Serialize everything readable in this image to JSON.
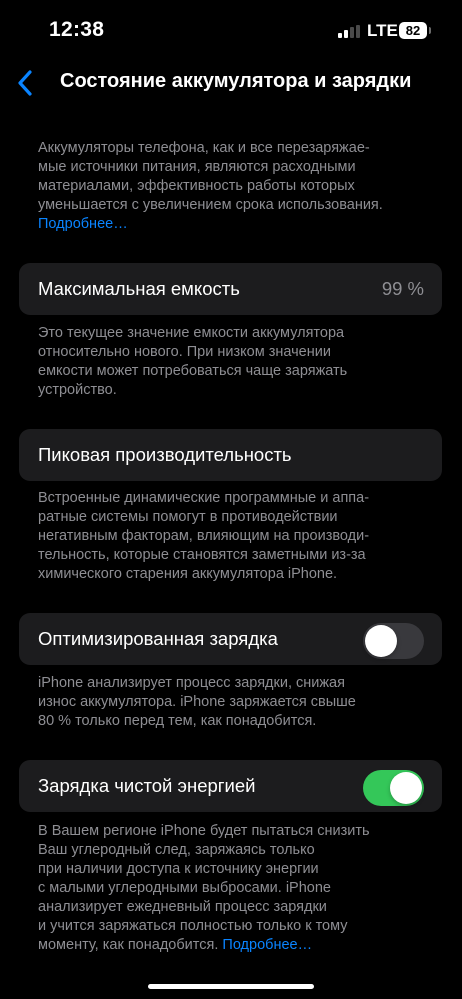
{
  "status_bar": {
    "time": "12:38",
    "network": "LTE",
    "battery_level": "82"
  },
  "nav": {
    "title": "Состояние аккумулятора и зарядки",
    "back_icon": "chevron-left-icon"
  },
  "intro": {
    "lines": [
      "Аккумуляторы телефона, как и все перезаряжае-",
      "мые источники питания, являются расходными",
      "материалами, эффективность работы которых",
      "уменьшается с увеличением срока использования."
    ],
    "link": "Подробнее…"
  },
  "max_capacity": {
    "label": "Максимальная емкость",
    "value": "99 %",
    "footer_lines": [
      "Это текущее значение емкости аккумулятора",
      "относительно нового. При низком значении",
      "емкости может потребоваться чаще заряжать",
      "устройство."
    ]
  },
  "peak_performance": {
    "label": "Пиковая производительность",
    "footer_lines": [
      "Встроенные динамические программные и аппа-",
      "ратные системы помогут в противодействии",
      "негативным факторам, влияющим на производи-",
      "тельность, которые становятся заметными из-за",
      "химического старения аккумулятора iPhone."
    ]
  },
  "optimized_charging": {
    "label": "Оптимизированная зарядка",
    "enabled": false,
    "footer_lines": [
      "iPhone анализирует процесс зарядки, снижая",
      "износ аккумулятора. iPhone заряжается свыше",
      "80 % только перед тем, как понадобится."
    ]
  },
  "clean_energy_charging": {
    "label": "Зарядка чистой энергией",
    "enabled": true,
    "footer_lines": [
      "В Вашем регионе iPhone будет пытаться снизить",
      "Ваш углеродный след, заряжаясь только",
      "при наличии доступа к источнику энергии",
      "с малыми углеродными выбросами. iPhone",
      "анализирует ежедневный процесс зарядки",
      "и учится заряжаться полностью только к тому"
    ],
    "footer_last_line": "моменту, как понадобится.",
    "link": "Подробнее…"
  },
  "colors": {
    "background": "#000000",
    "cell_background": "#1c1c1e",
    "secondary_text": "#8e8e93",
    "link": "#0a84ff",
    "toggle_on": "#34c759",
    "toggle_off": "#39393d"
  }
}
